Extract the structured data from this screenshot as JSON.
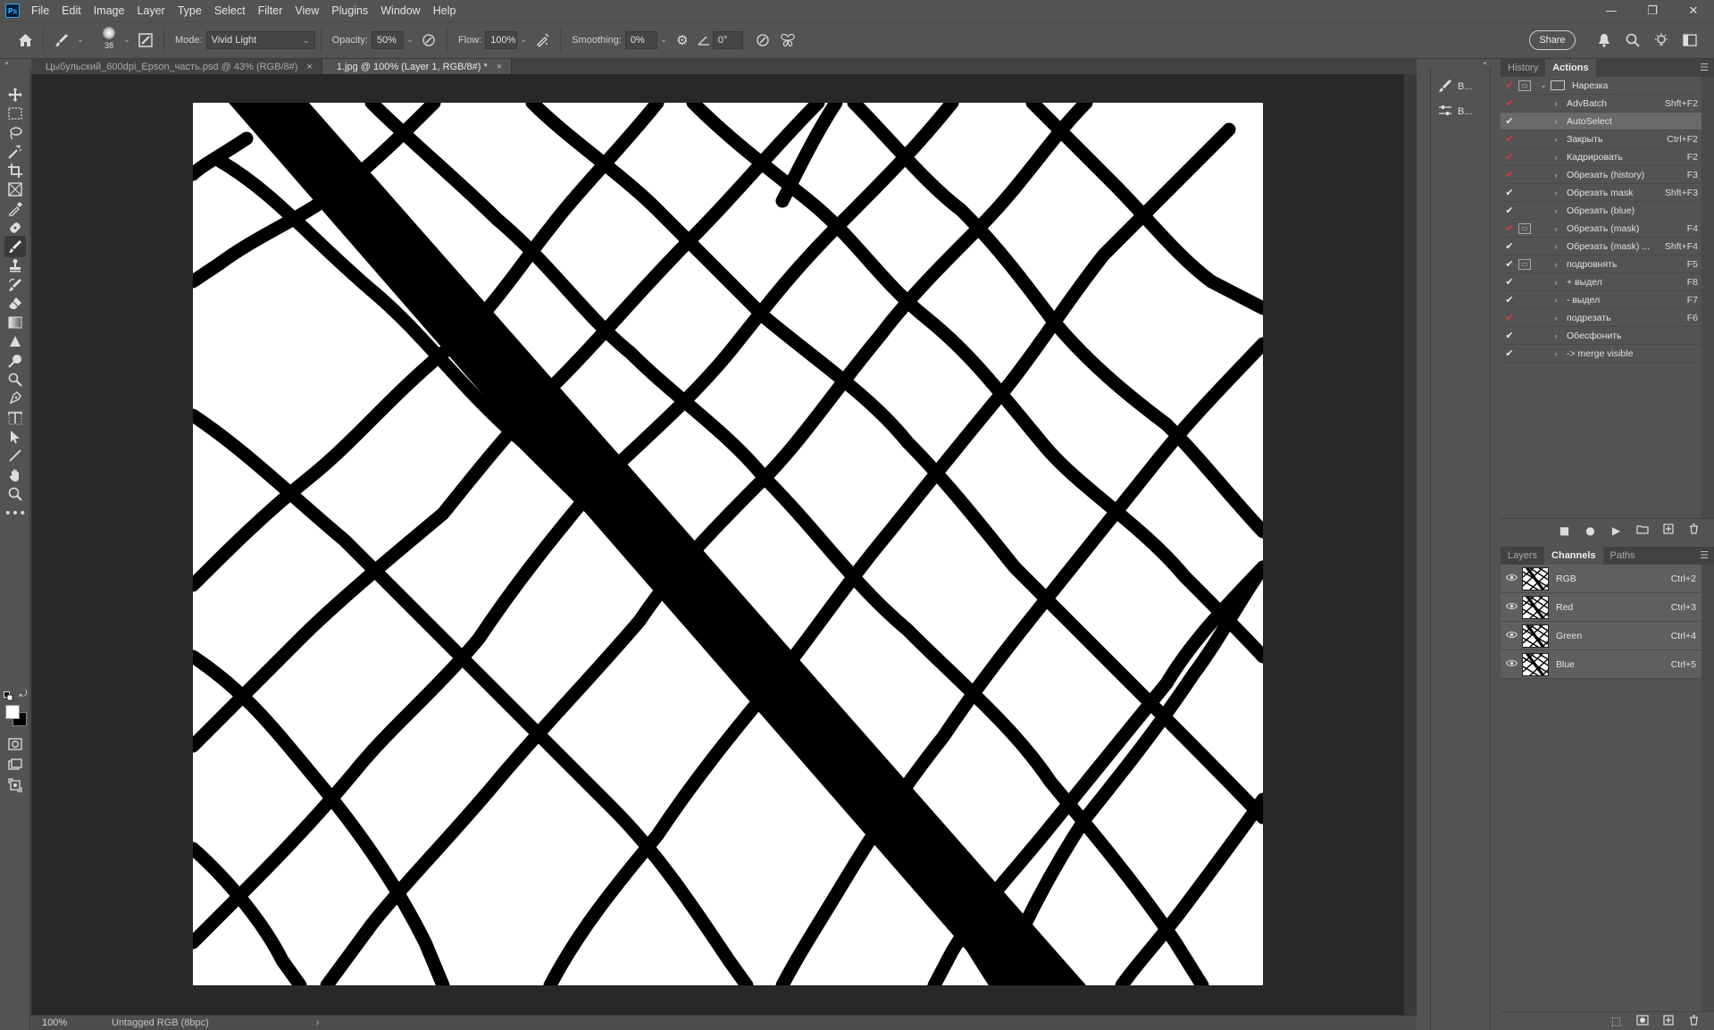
{
  "app": {
    "logo": "Ps"
  },
  "menu": [
    "File",
    "Edit",
    "Image",
    "Layer",
    "Type",
    "Select",
    "Filter",
    "View",
    "Plugins",
    "Window",
    "Help"
  ],
  "window_controls": {
    "minimize": "—",
    "restore": "❐",
    "close": "✕"
  },
  "options": {
    "brush_size": "38",
    "mode_label": "Mode:",
    "mode_value": "Vivid Light",
    "opacity_label": "Opacity:",
    "opacity_value": "50%",
    "flow_label": "Flow:",
    "flow_value": "100%",
    "smoothing_label": "Smoothing:",
    "smoothing_value": "0%",
    "angle_value": "0°",
    "share_label": "Share"
  },
  "tabs": [
    {
      "title": "Цыбульский_600dpi_Epson_часть.psd @ 43% (RGB/8#)",
      "active": false,
      "close": "×"
    },
    {
      "title": "1.jpg @ 100% (Layer 1, RGB/8#) *",
      "active": true,
      "close": "×"
    }
  ],
  "status": {
    "zoom": "100%",
    "info": "Untagged RGB (8bpc)",
    "arrow": "›"
  },
  "mini_panel": [
    {
      "label": "B..."
    },
    {
      "label": "B..."
    }
  ],
  "history_panel": {
    "tabs": [
      "History",
      "Actions"
    ],
    "active_tab": "Actions",
    "set_name": "Нарезка",
    "actions": [
      {
        "name": "AdvBatch",
        "key": "Shft+F2",
        "check": "red",
        "dialog": false,
        "selected": false
      },
      {
        "name": "AutoSelect",
        "key": "",
        "check": "white",
        "dialog": false,
        "selected": true
      },
      {
        "name": "Закрыть",
        "key": "Ctrl+F2",
        "check": "red",
        "dialog": false,
        "selected": false
      },
      {
        "name": "Кадрировать",
        "key": "F2",
        "check": "red",
        "dialog": false,
        "selected": false
      },
      {
        "name": "Обрезать (history)",
        "key": "F3",
        "check": "red",
        "dialog": false,
        "selected": false
      },
      {
        "name": "Обрезать mask",
        "key": "Shft+F3",
        "check": "white",
        "dialog": false,
        "selected": false
      },
      {
        "name": "Обрезать (blue)",
        "key": "",
        "check": "white",
        "dialog": false,
        "selected": false
      },
      {
        "name": "Обрезать (mask)",
        "key": "F4",
        "check": "red",
        "dialog": true,
        "selected": false
      },
      {
        "name": "Обрезать (mask) ...",
        "key": "Shft+F4",
        "check": "white",
        "dialog": false,
        "selected": false
      },
      {
        "name": "подровнять",
        "key": "F5",
        "check": "white",
        "dialog": true,
        "selected": false
      },
      {
        "name": "+ выдел",
        "key": "F8",
        "check": "white",
        "dialog": false,
        "selected": false
      },
      {
        "name": "- выдел",
        "key": "F7",
        "check": "white",
        "dialog": false,
        "selected": false
      },
      {
        "name": "подрезать",
        "key": "F6",
        "check": "red",
        "dialog": false,
        "selected": false
      },
      {
        "name": "Обесфонить",
        "key": "",
        "check": "white",
        "dialog": false,
        "selected": false
      },
      {
        "name": "-> merge visible",
        "key": "",
        "check": "white",
        "dialog": false,
        "selected": false
      }
    ]
  },
  "layers_panel": {
    "tabs": [
      "Layers",
      "Channels",
      "Paths"
    ],
    "active_tab": "Channels",
    "channels": [
      {
        "name": "RGB",
        "key": "Ctrl+2"
      },
      {
        "name": "Red",
        "key": "Ctrl+3"
      },
      {
        "name": "Green",
        "key": "Ctrl+4"
      },
      {
        "name": "Blue",
        "key": "Ctrl+5"
      }
    ]
  }
}
